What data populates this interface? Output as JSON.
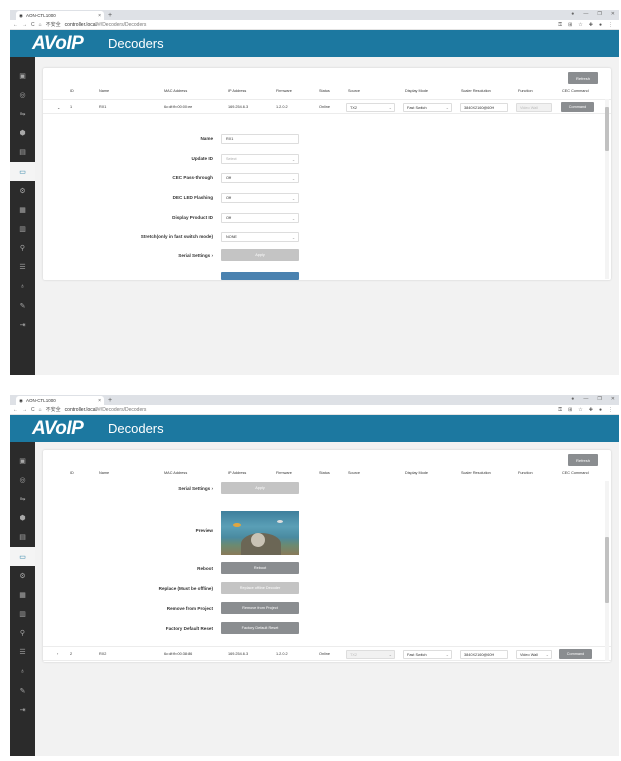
{
  "browser": {
    "tab_title": "AON-CTL1000",
    "tab_close": "×",
    "new_tab": "+",
    "window_controls": [
      "●",
      "—",
      "❐",
      "✕"
    ],
    "nav": [
      "←",
      "→",
      "C",
      "⌂"
    ],
    "security_label": "不安全",
    "url_host": "controller.local",
    "url_path": "/#/Decoders/Decoders",
    "url_path_2": "/#/Decoders/Decoders"
  },
  "app": {
    "logo": "AVoIP",
    "page_title": "Decoders"
  },
  "sidebar": {
    "icons": [
      "▣",
      "◎",
      "⇋",
      "⬢",
      "▤",
      "▭",
      "⚙",
      "▦",
      "▥",
      "⚲",
      "☰",
      "♁",
      "✎",
      "⇥"
    ],
    "active_index": 5
  },
  "table": {
    "refresh_label": "Refresh",
    "columns": [
      "ID",
      "Name",
      "MAC Address",
      "IP Address",
      "Firmware",
      "Status",
      "Source",
      "Display Mode",
      "Scaler Resolution",
      "Function",
      "CEC Command"
    ],
    "rows": [
      {
        "expand": "⌄",
        "id": "1",
        "name": "RX1",
        "mac": "6c:df:fb:00:00:ee",
        "ip": "169.254.6.3",
        "firmware": "1.2.0.2",
        "status": "Online",
        "source": "TX2",
        "display_mode": "Fast Switch",
        "scaler_resolution": "3840X2160@60H",
        "function": "Video Wall",
        "cec_command": "Command"
      },
      {
        "expand": "›",
        "id": "2",
        "name": "RX2",
        "mac": "6c:df:fb:00:38:86",
        "ip": "169.254.6.3",
        "firmware": "1.2.0.2",
        "status": "Online",
        "source": "TX2",
        "display_mode": "Fast Switch",
        "scaler_resolution": "3840X2160@60H",
        "function": "Video Wall",
        "cec_command": "Command"
      }
    ]
  },
  "detail": {
    "name_label": "Name",
    "name_value": "RX1",
    "update_id_label": "Update ID",
    "update_id_placeholder": "Select",
    "cec_pass_label": "CEC Pass-through",
    "cec_pass_value": "Off",
    "dec_led_label": "DEC LED Flashing",
    "dec_led_value": "Off",
    "display_pid_label": "Display Product ID",
    "display_pid_value": "Off",
    "stretch_label": "Stretch(only in fast switch mode)",
    "stretch_value": "NONE",
    "serial_label": "Serial Settings",
    "serial_chevron": "›",
    "apply_label": "Apply",
    "preview_label": "Preview",
    "reboot_label": "Reboot",
    "reboot_button": "Reboot",
    "replace_label": "Replace (Must be offline)",
    "replace_button": "Replace offline Decoder",
    "remove_label": "Remove from Project",
    "remove_button": "Remove from Project",
    "factory_label": "Factory Default Reset",
    "factory_button": "Factory Default Reset"
  }
}
